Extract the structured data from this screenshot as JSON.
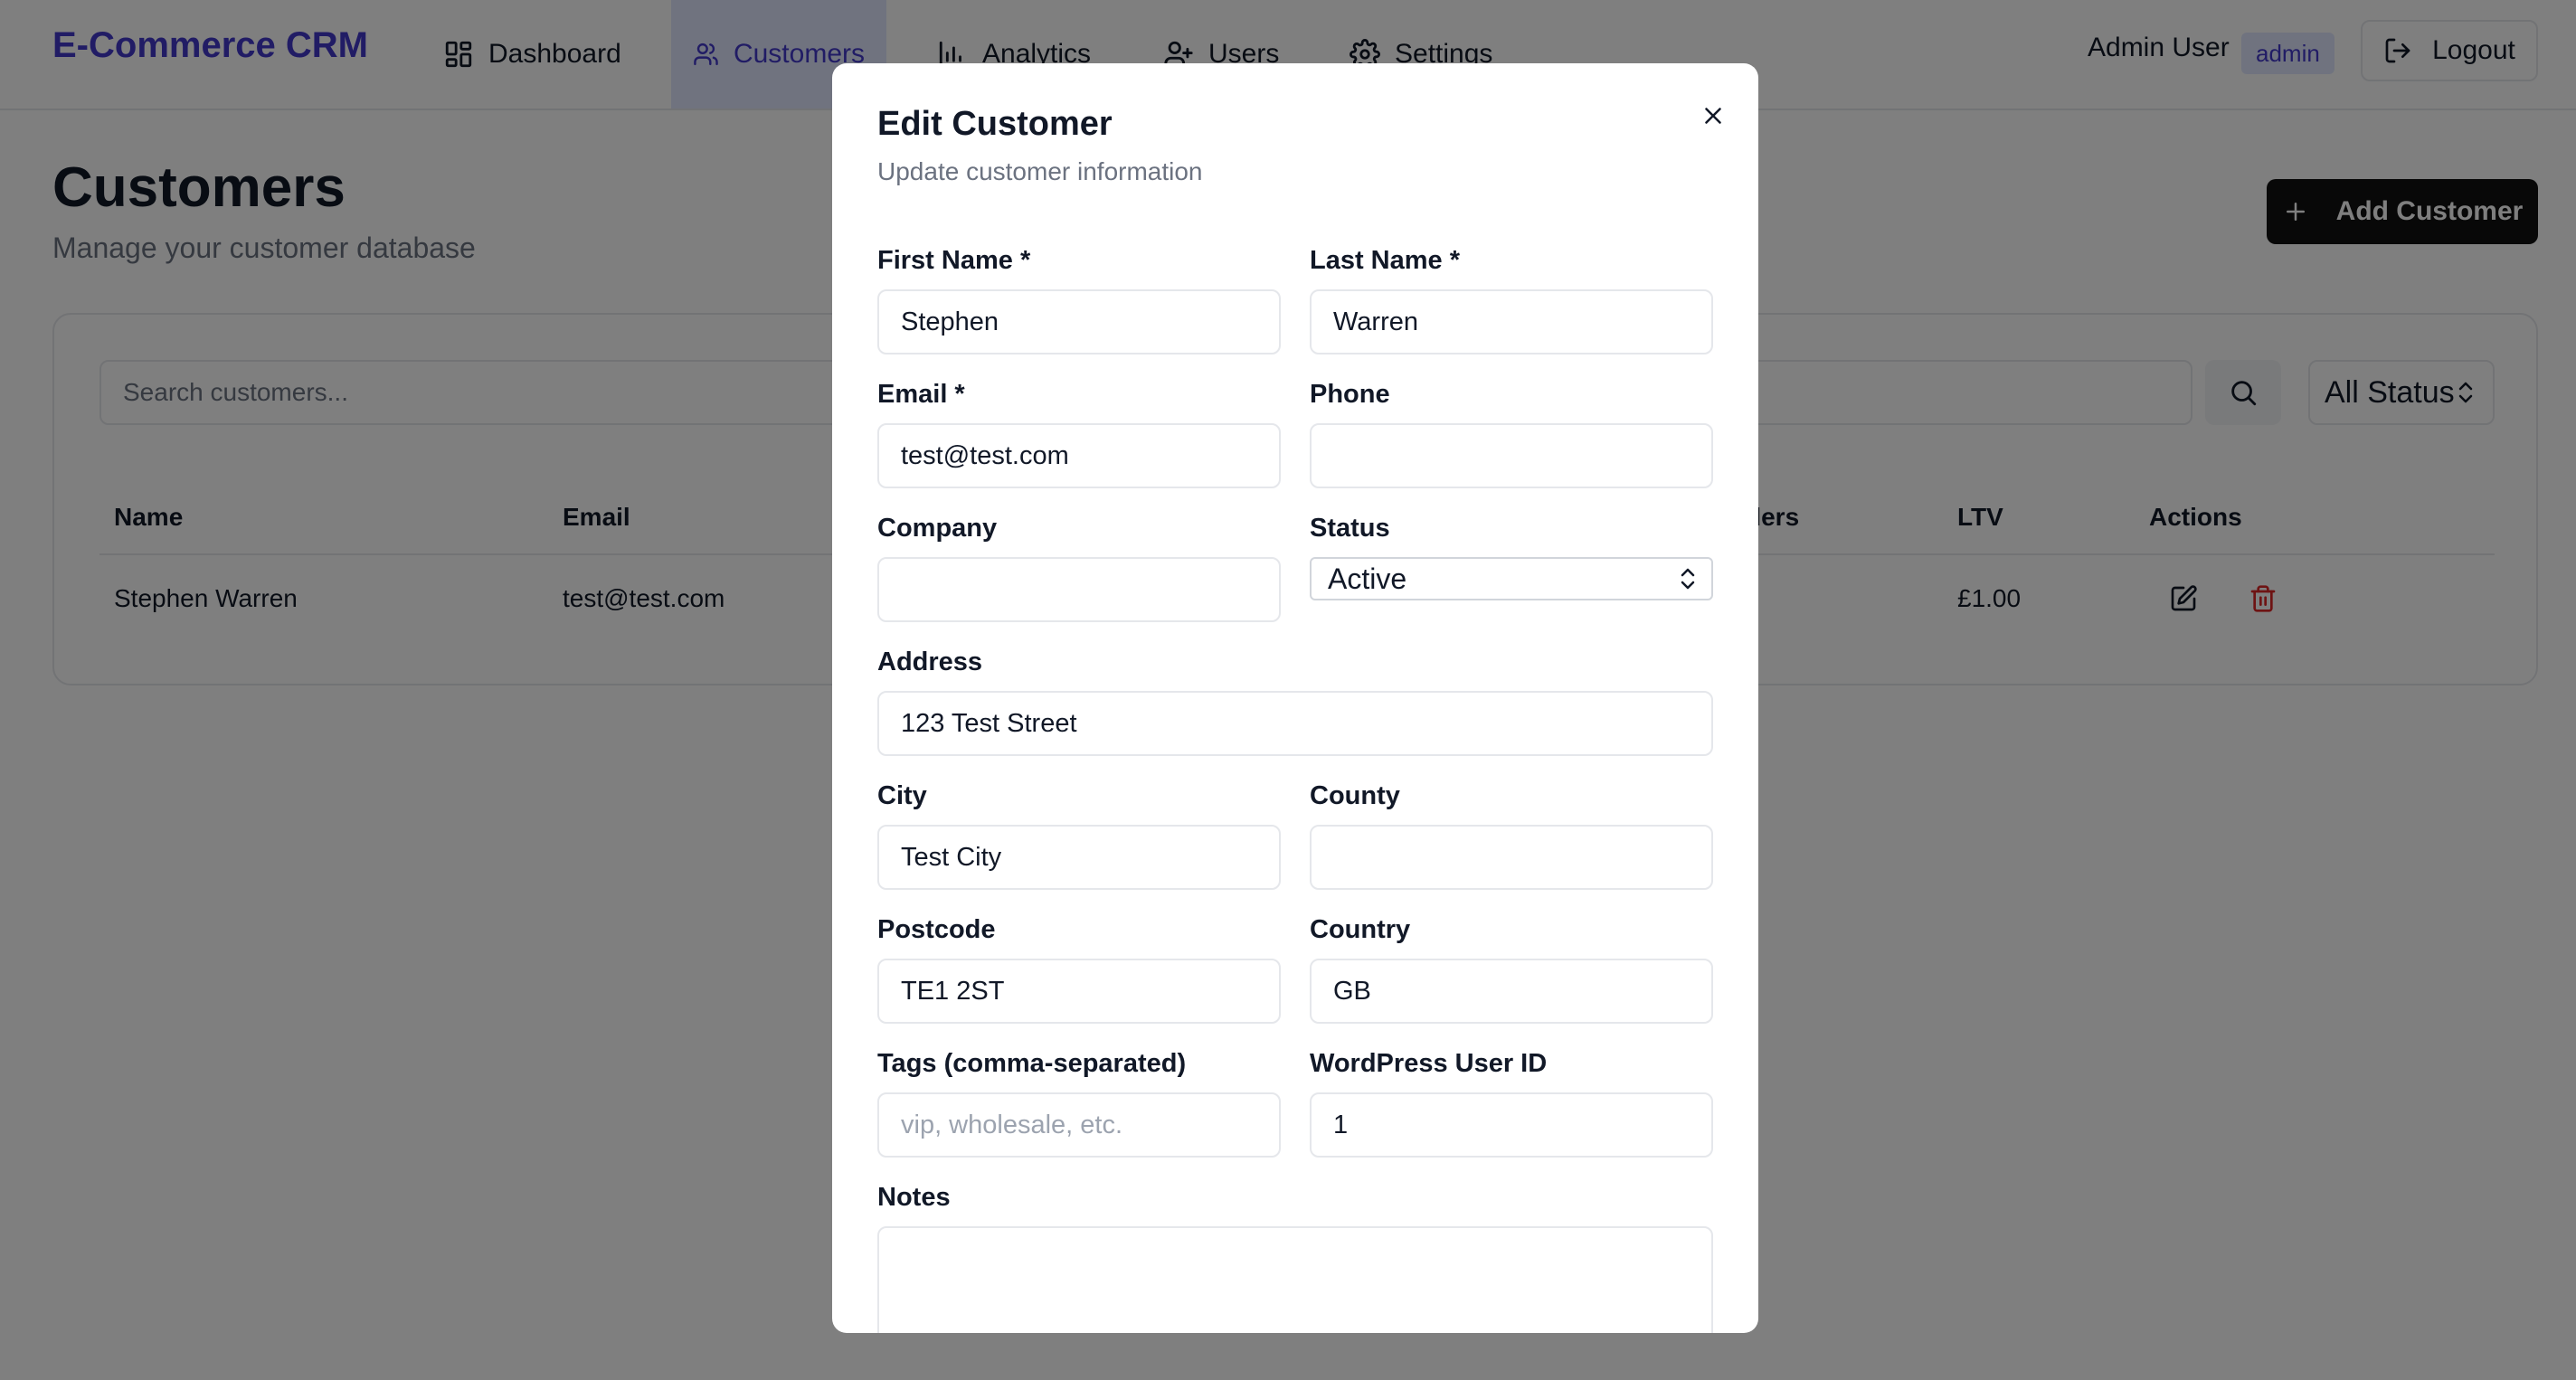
{
  "nav": {
    "brand": "E-Commerce CRM",
    "items": [
      {
        "label": "Dashboard"
      },
      {
        "label": "Customers"
      },
      {
        "label": "Analytics"
      },
      {
        "label": "Users"
      },
      {
        "label": "Settings"
      }
    ],
    "user_name": "Admin User",
    "user_role": "admin",
    "logout_label": "Logout"
  },
  "page": {
    "title": "Customers",
    "subtitle": "Manage your customer database",
    "add_button_label": "Add Customer"
  },
  "filters": {
    "search_placeholder": "Search customers...",
    "status_value": "All Status"
  },
  "table": {
    "columns": [
      "Name",
      "Email",
      "ders",
      "LTV",
      "Actions"
    ],
    "rows": [
      {
        "name": "Stephen Warren",
        "email": "test@test.com",
        "ltv": "£1.00"
      }
    ]
  },
  "modal": {
    "title": "Edit Customer",
    "description": "Update customer information",
    "fields": {
      "first_name": {
        "label": "First Name *",
        "value": "Stephen"
      },
      "last_name": {
        "label": "Last Name *",
        "value": "Warren"
      },
      "email": {
        "label": "Email *",
        "value": "test@test.com"
      },
      "phone": {
        "label": "Phone",
        "value": ""
      },
      "company": {
        "label": "Company",
        "value": ""
      },
      "status": {
        "label": "Status",
        "value": "Active"
      },
      "address": {
        "label": "Address",
        "value": "123 Test Street"
      },
      "city": {
        "label": "City",
        "value": "Test City"
      },
      "county": {
        "label": "County",
        "value": ""
      },
      "postcode": {
        "label": "Postcode",
        "value": "TE1 2ST"
      },
      "country": {
        "label": "Country",
        "value": "GB"
      },
      "tags": {
        "label": "Tags (comma-separated)",
        "value": "",
        "placeholder": "vip, wholesale, etc."
      },
      "wp_user_id": {
        "label": "WordPress User ID",
        "value": "1"
      },
      "notes": {
        "label": "Notes",
        "value": ""
      }
    }
  },
  "colors": {
    "brand": "#4338ca",
    "active_nav_bg": "#e0e7ff",
    "primary_button": "#111111",
    "delete_icon": "#dc2626"
  }
}
